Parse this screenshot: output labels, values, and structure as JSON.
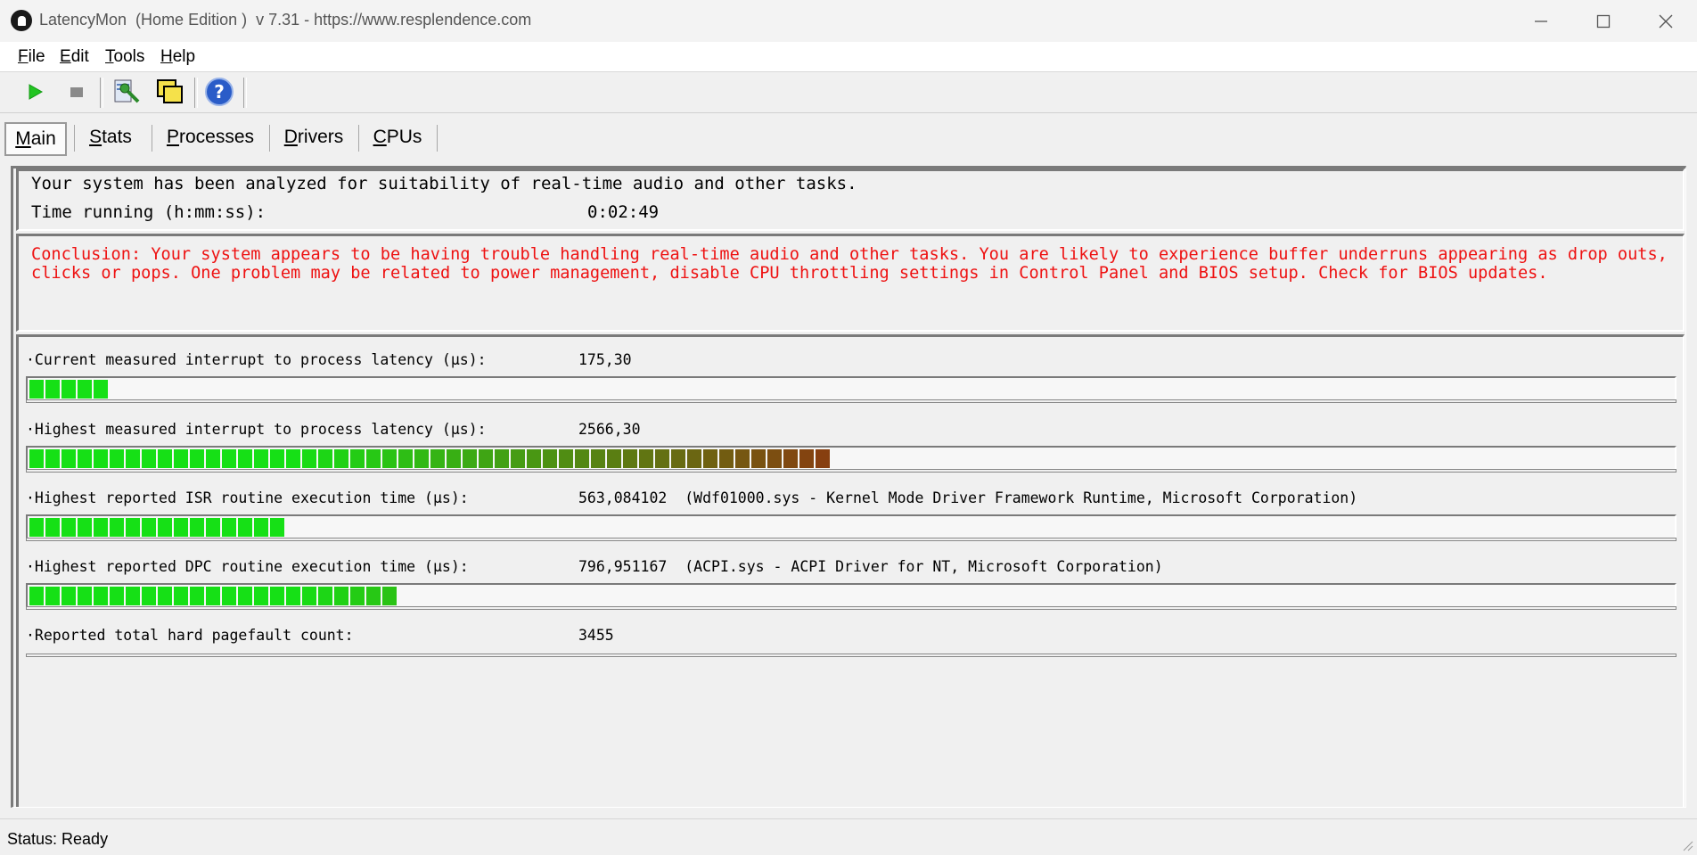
{
  "window": {
    "title": "LatencyMon  (Home Edition )  v 7.31 - https://www.resplendence.com"
  },
  "menu": [
    {
      "label": "File",
      "accel": "F",
      "rest": "ile"
    },
    {
      "label": "Edit",
      "accel": "E",
      "rest": "dit"
    },
    {
      "label": "Tools",
      "accel": "T",
      "rest": "ools"
    },
    {
      "label": "Help",
      "accel": "H",
      "rest": "elp"
    }
  ],
  "toolbar": {
    "icons": [
      "play-icon",
      "stop-icon",
      "report-icon",
      "windows-icon",
      "help-icon"
    ]
  },
  "tabs": [
    {
      "accel": "M",
      "rest": "ain",
      "active": true
    },
    {
      "accel": "S",
      "rest": "tats",
      "active": false
    },
    {
      "accel": "P",
      "rest": "rocesses",
      "active": false
    },
    {
      "accel": "D",
      "rest": "rivers",
      "active": false
    },
    {
      "accel": "C",
      "rest": "PUs",
      "active": false
    }
  ],
  "summary": {
    "analyzed": "Your system has been analyzed for suitability of real-time audio and other tasks.",
    "time_label": "Time running (h:mm:ss):",
    "time_value": "0:02:49"
  },
  "conclusion": "Conclusion: Your system appears to be having trouble handling real-time audio and other tasks. You are likely to experience buffer underruns appearing as drop outs, clicks or pops. One problem may be related to power management, disable CPU throttling settings in Control Panel and BIOS setup. Check for BIOS updates.",
  "metrics": [
    {
      "label": "·Current measured interrupt to process latency (µs):",
      "value": "175,30",
      "segments": 5
    },
    {
      "label": "·Highest measured interrupt to process latency (µs):",
      "value": "2566,30",
      "segments": 50
    },
    {
      "label": "·Highest reported ISR routine execution time (µs):",
      "value": "563,084102  (Wdf01000.sys - Kernel Mode Driver Framework Runtime, Microsoft Corporation)",
      "segments": 16
    },
    {
      "label": "·Highest reported DPC routine execution time (µs):",
      "value": "796,951167  (ACPI.sys - ACPI Driver for NT, Microsoft Corporation)",
      "segments": 23
    },
    {
      "label": "·Reported total hard pagefault count:",
      "value": "3455",
      "segments": null
    }
  ],
  "colors": {
    "conclusion_text": "#ee1111",
    "bar_green": "#16e016",
    "bar_brown": "#8a3a10"
  },
  "status": "Status: Ready"
}
